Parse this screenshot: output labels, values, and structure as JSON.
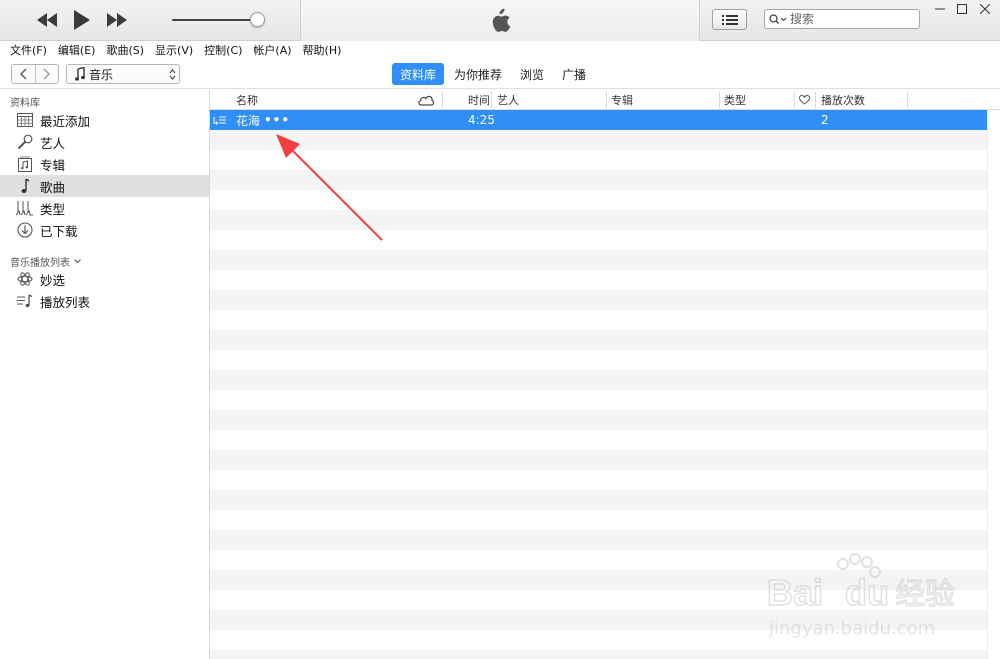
{
  "topbar": {
    "search": {
      "placeholder": "搜索"
    }
  },
  "menu": [
    "文件(F)",
    "编辑(E)",
    "歌曲(S)",
    "显示(V)",
    "控制(C)",
    "帐户(A)",
    "帮助(H)"
  ],
  "nav": {
    "media_kind": "音乐",
    "tabs": [
      {
        "label": "资料库",
        "active": true
      },
      {
        "label": "为你推荐",
        "active": false
      },
      {
        "label": "浏览",
        "active": false
      },
      {
        "label": "广播",
        "active": false
      }
    ]
  },
  "sidebar": {
    "library_header": "资料库",
    "library_items": [
      {
        "label": "最近添加",
        "icon": "grid-calendar-icon"
      },
      {
        "label": "艺人",
        "icon": "microphone-icon"
      },
      {
        "label": "专辑",
        "icon": "album-icon"
      },
      {
        "label": "歌曲",
        "icon": "music-note-icon",
        "selected": true
      },
      {
        "label": "类型",
        "icon": "genre-icon"
      },
      {
        "label": "已下载",
        "icon": "download-icon"
      }
    ],
    "playlists_header": "音乐播放列表",
    "playlist_items": [
      {
        "label": "妙选",
        "icon": "genius-atom-icon"
      },
      {
        "label": "播放列表",
        "icon": "playlist-icon"
      }
    ]
  },
  "song_list": {
    "columns": {
      "name": "名称",
      "time": "时间",
      "artist": "艺人",
      "album": "专辑",
      "genre": "类型",
      "plays": "播放次数"
    },
    "rows": [
      {
        "name": "花海",
        "more": "•••",
        "time": "4:25",
        "artist": "",
        "album": "",
        "genre": "",
        "plays": "2"
      }
    ]
  },
  "watermark": {
    "brand": "Bai du 经验",
    "url": "jingyan.baidu.com"
  },
  "colors": {
    "accent": "#2f8ff7",
    "annotation": "#f04040"
  }
}
